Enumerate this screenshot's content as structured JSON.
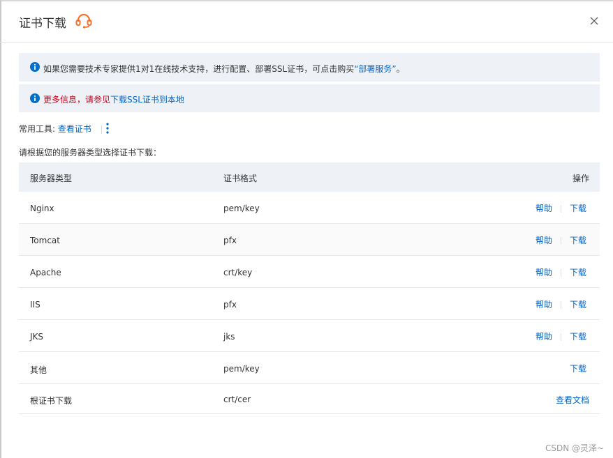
{
  "dialog": {
    "title": "证书下载",
    "support_icon": "headset-icon",
    "close_icon": "close-icon"
  },
  "notices": {
    "first": {
      "text": "如果您需要技术专家提供1对1在线技术支持，进行配置、部署SSL证书，可点击购买",
      "link_text": "“部署服务”",
      "suffix": "。"
    },
    "second": {
      "prefix": "更多信息，请参见",
      "link_text": "下载SSL证书到本地"
    }
  },
  "tools": {
    "label": "常用工具:",
    "view_cert_link": "查看证书",
    "more_icon": "more-vertical-icon"
  },
  "prompt": "请根据您的服务器类型选择证书下载：",
  "table": {
    "headers": {
      "server_type": "服务器类型",
      "format": "证书格式",
      "ops": "操作"
    },
    "rows": [
      {
        "server": "Nginx",
        "format": "pem/key",
        "help": "帮助",
        "download": "下载"
      },
      {
        "server": "Tomcat",
        "format": "pfx",
        "help": "帮助",
        "download": "下载"
      },
      {
        "server": "Apache",
        "format": "crt/key",
        "help": "帮助",
        "download": "下载"
      },
      {
        "server": "IIS",
        "format": "pfx",
        "help": "帮助",
        "download": "下载"
      },
      {
        "server": "JKS",
        "format": "jks",
        "help": "帮助",
        "download": "下载"
      },
      {
        "server": "其他",
        "format": "pem/key",
        "download": "下载"
      },
      {
        "server": "根证书下载",
        "format": "crt/cer",
        "docs": "查看文档"
      }
    ]
  },
  "watermark": "CSDN @灵泽~",
  "colors": {
    "link": "#0064c8",
    "warning_text": "#d0021b",
    "info_icon": "#0070cc",
    "support_icon": "#f5712c",
    "notice_bg": "#eef2f7"
  }
}
